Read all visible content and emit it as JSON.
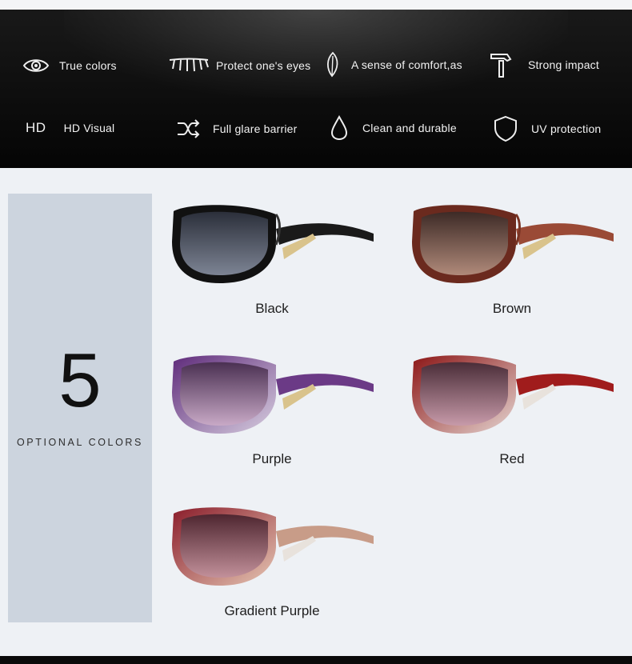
{
  "features": [
    {
      "id": "true-colors",
      "label": "True colors",
      "icon": "eye-icon"
    },
    {
      "id": "protect-eyes",
      "label": "Protect one's eyes",
      "icon": "eyelashes-icon"
    },
    {
      "id": "comfort",
      "label": "A sense of comfort,as",
      "icon": "feather-icon"
    },
    {
      "id": "impact",
      "label": "Strong impact",
      "icon": "hammer-icon"
    },
    {
      "id": "hd-visual",
      "label": "HD Visual",
      "icon": "hd-icon",
      "icon_text": "HD"
    },
    {
      "id": "glare",
      "label": "Full glare barrier",
      "icon": "shuffle-arrows-icon"
    },
    {
      "id": "clean",
      "label": "Clean and durable",
      "icon": "water-drop-icon"
    },
    {
      "id": "uv",
      "label": "UV protection",
      "icon": "shield-icon"
    }
  ],
  "colors_panel": {
    "count": "5",
    "label": "OPTIONAL COLORS"
  },
  "products": [
    {
      "name": "Black",
      "frame": "#111111",
      "frame2": "#2a2a2a",
      "lens_top": "#2b2f3a",
      "lens_bottom": "#7d8494"
    },
    {
      "name": "Brown",
      "frame": "#6b2a1e",
      "frame2": "#9a4a36",
      "lens_top": "#3d2a26",
      "lens_bottom": "#b08a7a"
    },
    {
      "name": "Purple",
      "frame": "#5e2a7a",
      "frame2": "#d8cfe0",
      "lens_top": "#4a3052",
      "lens_bottom": "#c8a9c6"
    },
    {
      "name": "Red",
      "frame": "#8c1515",
      "frame2": "#e5d6d2",
      "lens_top": "#4a2d38",
      "lens_bottom": "#c79aa9"
    },
    {
      "name": "Gradient Purple",
      "frame": "#8a1c2a",
      "frame2": "#e6c7b4",
      "lens_top": "#4e2630",
      "lens_bottom": "#c2909a"
    }
  ]
}
